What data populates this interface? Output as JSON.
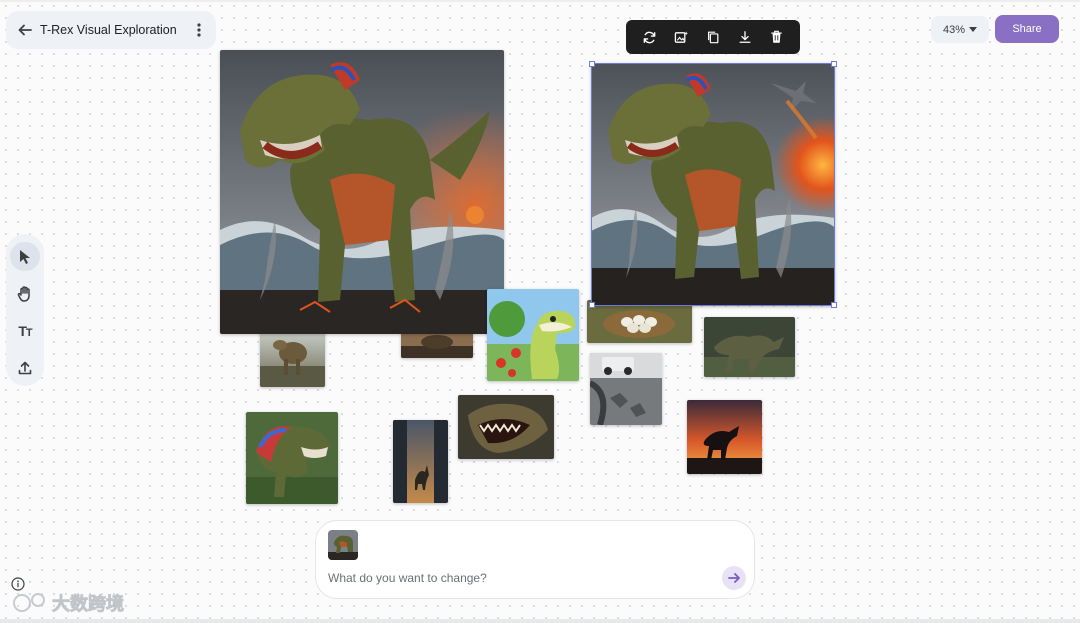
{
  "header": {
    "title": "T-Rex Visual Exploration",
    "back_icon": "arrow-left-icon",
    "menu_icon": "kebab-menu-icon"
  },
  "top_right": {
    "zoom_label": "43%",
    "share_label": "Share"
  },
  "colors": {
    "accent": "#8a70c4",
    "selection": "#6f7bd8",
    "toolbar_bg": "#eef1f6",
    "dark_toolbar": "#1f1f1f"
  },
  "left_toolbar": {
    "tools": [
      {
        "name": "select-tool",
        "icon": "cursor-icon",
        "active": true
      },
      {
        "name": "pan-tool",
        "icon": "hand-icon",
        "active": false
      },
      {
        "name": "text-tool",
        "icon": "text-icon",
        "label": "Tт"
      },
      {
        "name": "upload-tool",
        "icon": "upload-icon",
        "active": false
      }
    ]
  },
  "image_toolbar": {
    "actions": [
      "regenerate-icon",
      "edit-image-icon",
      "duplicate-icon",
      "download-icon",
      "delete-icon"
    ]
  },
  "canvas": {
    "images": [
      "T-Rex roaring on volcanic beach",
      "T-Rex roaring on volcanic beach with jet and explosion (selected)",
      "T-Rex walking in jungle",
      "T-Rex at sunset",
      "Cartoon dinosaur with apples",
      "Dinosaur eggs in nest",
      "T-Rex in forest",
      "Truck and footprints in mud",
      "T-Rex close-up roaring",
      "T-Rex sunset silhouette",
      "Colorful feathered T-Rex",
      "T-Rex in city street"
    ]
  },
  "prompt": {
    "placeholder": "What do you want to change?",
    "value": "",
    "send_icon": "arrow-right-icon"
  },
  "footer": {
    "info_icon": "info-icon",
    "watermark": "大数跨境"
  }
}
